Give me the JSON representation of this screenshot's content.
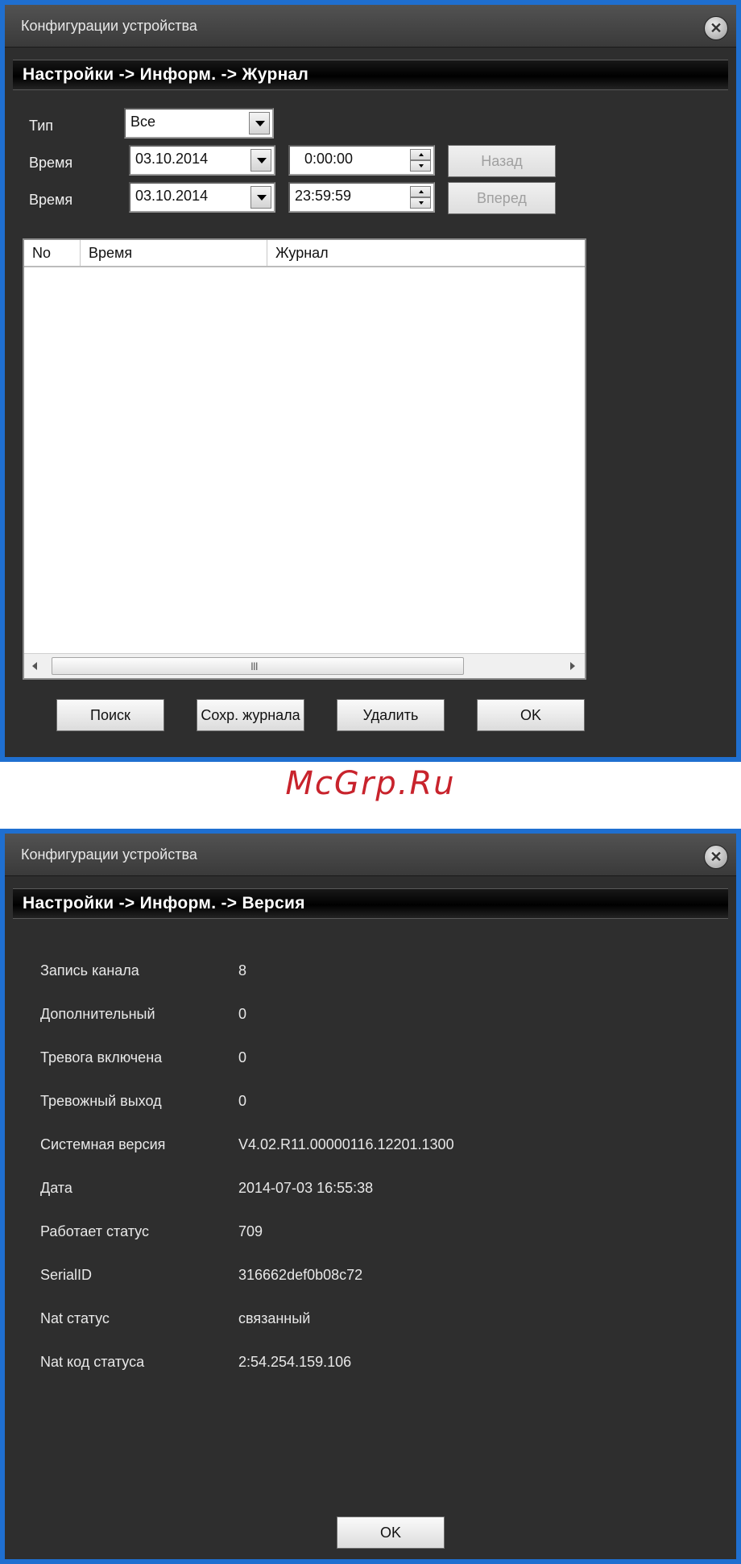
{
  "log_window": {
    "title": "Конфигурации устройства",
    "path": "Настройки -> Информ. -> Журнал",
    "type_label": "Тип",
    "type_value": "Все",
    "time_label_1": "Время",
    "time_label_2": "Время",
    "start_date": "03.10.2014",
    "start_time": "0:00:00",
    "end_date": "03.10.2014",
    "end_time": "23:59:59",
    "back_button": "Назад",
    "forward_button": "Вперед",
    "table": {
      "columns": [
        "No",
        "Время",
        "Журнал"
      ],
      "rows": []
    },
    "scroll_grip": "III",
    "buttons": {
      "search": "Поиск",
      "save_log": "Сохр. журнала",
      "delete": "Удалить",
      "ok": "OK"
    }
  },
  "watermark": "McGrp.Ru",
  "version_window": {
    "title": "Конфигурации устройства",
    "path": "Настройки -> Информ. -> Версия",
    "rows": [
      {
        "label": "Запись канала",
        "value": "8"
      },
      {
        "label": "Дополнительный",
        "value": "0"
      },
      {
        "label": "Тревога включена",
        "value": "0"
      },
      {
        "label": "Тревожный выход",
        "value": "0"
      },
      {
        "label": "Системная версия",
        "value": "V4.02.R11.00000116.12201.1300"
      },
      {
        "label": "Дата",
        "value": "2014-07-03 16:55:38"
      },
      {
        "label": "Работает статус",
        "value": "709"
      },
      {
        "label": "SerialID",
        "value": "316662def0b08c72"
      },
      {
        "label": "Nat статус",
        "value": "связанный"
      },
      {
        "label": "Nat код статуса",
        "value": "2:54.254.159.106"
      }
    ],
    "ok_button": "OK"
  }
}
